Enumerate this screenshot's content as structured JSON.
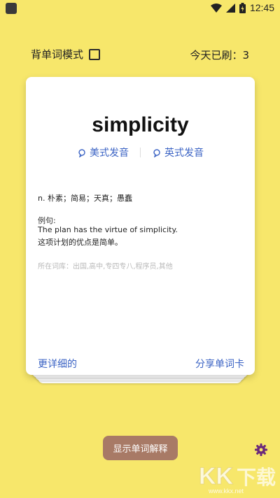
{
  "status": {
    "time": "12:45"
  },
  "header": {
    "mode_label": "背单词模式",
    "today_label": "今天已刷：",
    "today_count": "3"
  },
  "card": {
    "word": "simplicity",
    "pron_us": "美式发音",
    "pron_uk": "英式发音",
    "meaning": "n. 朴素；简易；天真；愚蠢",
    "example_label": "例句:",
    "example_en": "The plan has the virtue of simplicity.",
    "example_zh": "这项计划的优点是简单。",
    "tags": "所在词库：出国,高中,专四专八,程序员,其他",
    "more_link": "更详细的",
    "share_link": "分享单词卡"
  },
  "footer": {
    "show_button": "显示单词解释"
  },
  "watermark": {
    "logo": "KK下载",
    "url": "www.kkx.net"
  },
  "colors": {
    "background": "#f7e76b",
    "accent": "#3b63c4",
    "button": "#a87a66",
    "gear": "#6b2a7a"
  }
}
